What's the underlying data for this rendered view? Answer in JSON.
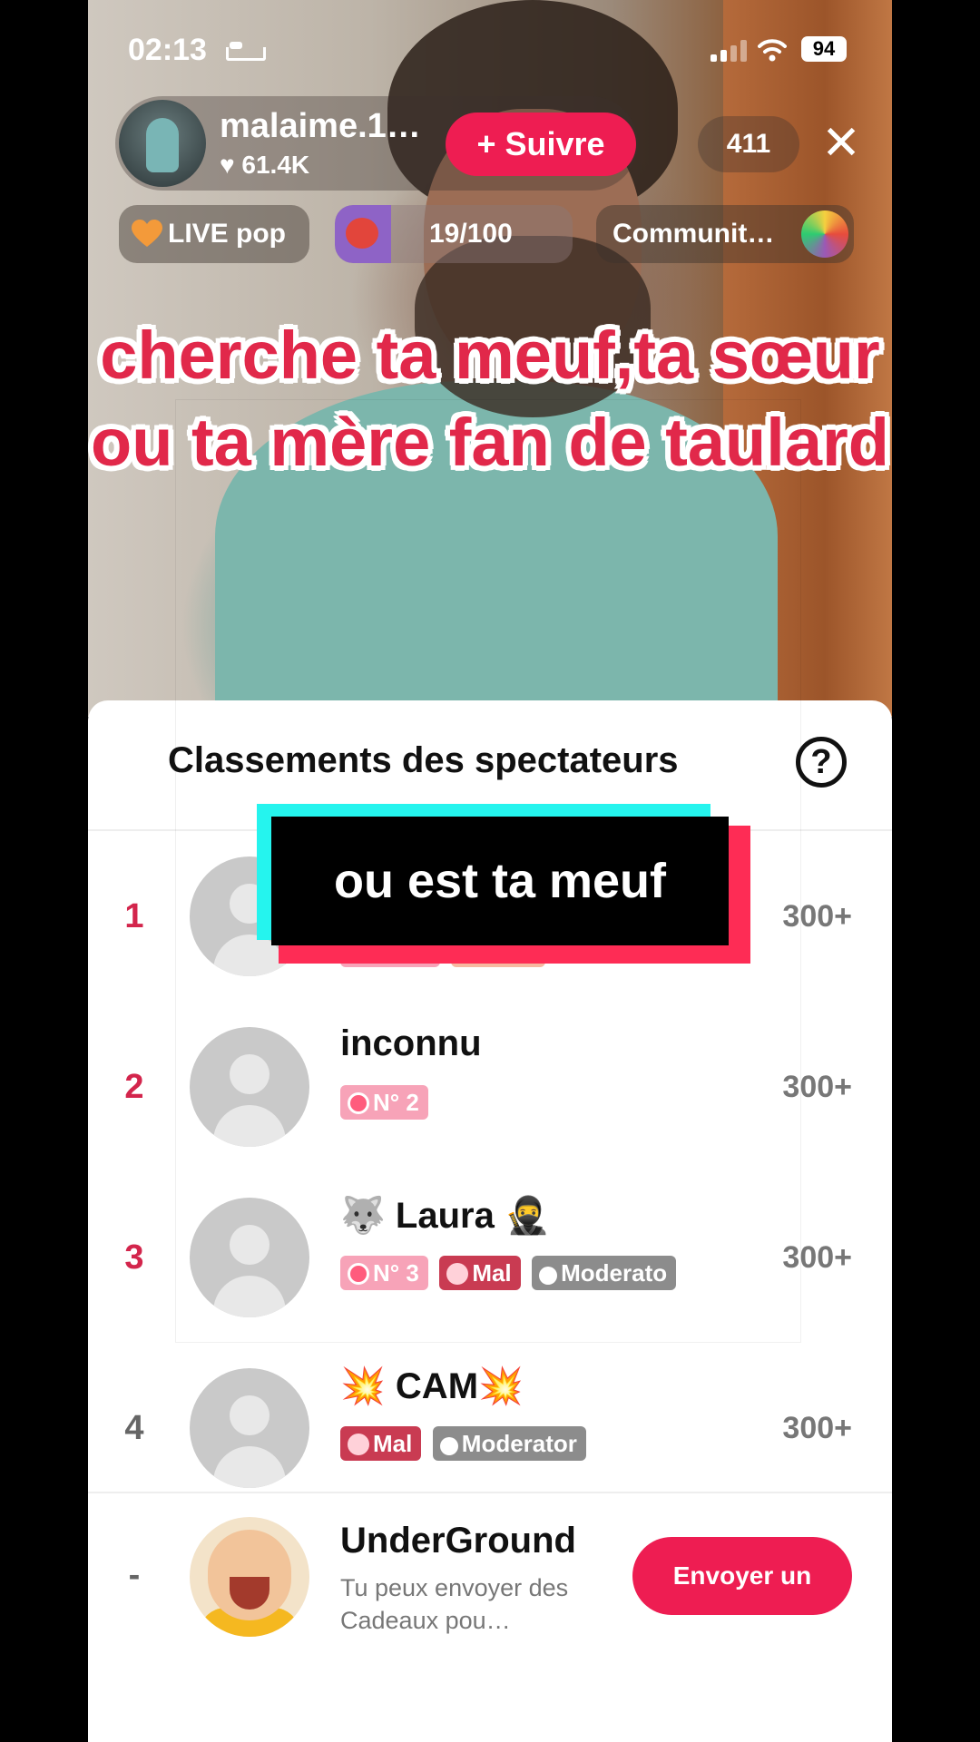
{
  "status_bar": {
    "time": "02:13",
    "battery": "94"
  },
  "host": {
    "name": "malaime.1…",
    "likes": "♥ 61.4K",
    "follow_label": "+ Suivre",
    "viewer_count": "411",
    "close_label": "✕"
  },
  "chips": {
    "live_label": "LIVE pop",
    "goal_progress": "19/100",
    "community_label": "Communit…"
  },
  "caption": "cherche ta meuf,ta sœur ou ta mère fan de taulard",
  "sticker_text": "ou est ta meuf",
  "sheet": {
    "title": "Classements des spectateurs",
    "help_label": "?",
    "rows": [
      {
        "rank": "1",
        "name": "",
        "score": "300+",
        "badges": []
      },
      {
        "rank": "2",
        "name": "inconnu",
        "score": "300+",
        "badges": [
          "N° 2"
        ]
      },
      {
        "rank": "3",
        "name": "🐺 Laura 🥷",
        "score": "300+",
        "badges": [
          "N° 3",
          "Mal",
          "Moderato"
        ]
      },
      {
        "rank": "4",
        "name": "💥 CAM💥",
        "score": "300+",
        "badges": [
          "Mal",
          "Moderator"
        ]
      }
    ],
    "self": {
      "rank": "-",
      "name": "UnderGround",
      "subtitle": "Tu peux envoyer des Cadeaux pou…",
      "button_label": "Envoyer un"
    }
  },
  "colors": {
    "accent": "#ee1d52",
    "rank_top": "#d3254c",
    "sticker_cyan": "#25f4ee",
    "sticker_red": "#fe2c55"
  },
  "icons": [
    "bed-icon",
    "signal-icon",
    "wifi-icon",
    "heart-icon",
    "close-icon",
    "help-icon"
  ]
}
